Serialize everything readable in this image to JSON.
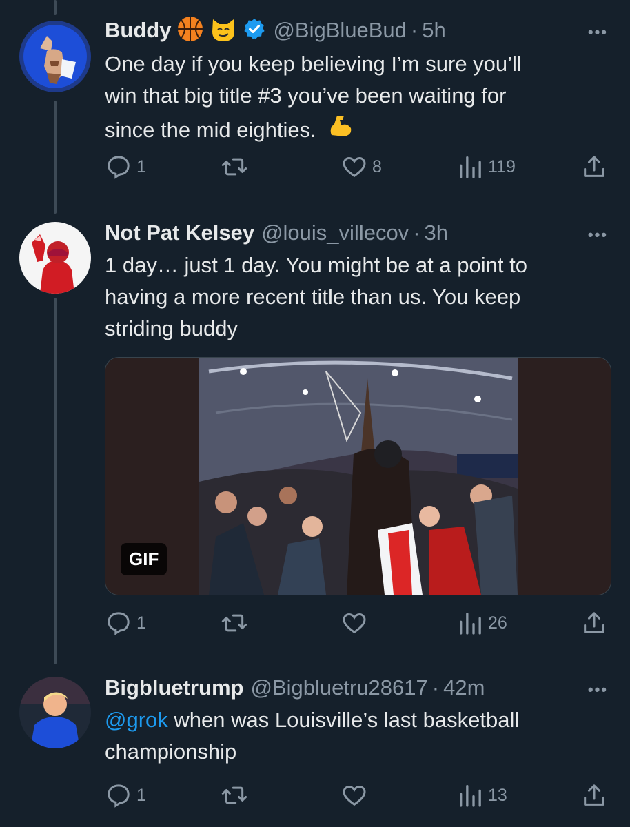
{
  "tweets": [
    {
      "name": "Buddy",
      "handle": "@BigBlueBud",
      "separator": "·",
      "time": "5h",
      "verified": true,
      "badges": [
        "basketball-emoji",
        "smirking-cat-emoji"
      ],
      "text_lines": [
        "One day if you keep believing I’m sure you’ll",
        "win that big title #3 you’ve been waiting for",
        "since the mid eighties."
      ],
      "trailing_emoji": "flexed-biceps-emoji",
      "replies": "1",
      "retweets": "",
      "likes": "8",
      "views": "119"
    },
    {
      "name": "Not Pat Kelsey",
      "handle": "@louis_villecov",
      "separator": "·",
      "time": "3h",
      "text_lines": [
        "1 day… just 1 day. You might be at a point to",
        "having a more recent title than us. You keep",
        "striding buddy"
      ],
      "media_badge": "GIF",
      "replies": "1",
      "retweets": "",
      "likes": "",
      "views": "26"
    },
    {
      "name": "Bigbluetrump",
      "handle": "@Bigbluetru28617",
      "separator": "·",
      "time": "42m",
      "mention": "@grok",
      "text_lines": [
        " when was Louisville’s last basketball",
        "championship"
      ],
      "replies": "1",
      "retweets": "",
      "likes": "",
      "views": "13"
    }
  ],
  "more_label": "•••",
  "colors": {
    "background": "#15202b",
    "text": "#e7e9ea",
    "muted": "#8b98a5",
    "accent": "#1d9bf0",
    "thread_line": "#3d4a56"
  }
}
